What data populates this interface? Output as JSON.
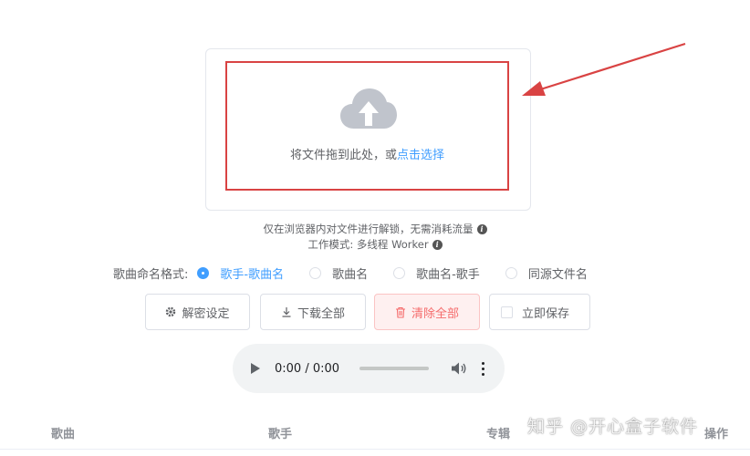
{
  "upload": {
    "drop_text": "将文件拖到此处，或",
    "drop_link": "点击选择"
  },
  "info": {
    "privacy_text": "仅在浏览器内对文件进行解锁，无需消耗流量",
    "mode_text": "工作模式: 多线程 Worker"
  },
  "naming": {
    "label": "歌曲命名格式:",
    "options": [
      {
        "label": "歌手-歌曲名",
        "checked": true
      },
      {
        "label": "歌曲名",
        "checked": false
      },
      {
        "label": "歌曲名-歌手",
        "checked": false
      },
      {
        "label": "同源文件名",
        "checked": false
      }
    ]
  },
  "buttons": {
    "decrypt_settings": "解密设定",
    "download_all": "下载全部",
    "clear_all": "清除全部",
    "save_now": "立即保存"
  },
  "player": {
    "time": "0:00 / 0:00",
    "progress": 0
  },
  "table": {
    "columns": [
      "歌曲",
      "歌手",
      "专辑",
      "操作"
    ]
  },
  "watermark": "知乎 @开心盒子软件",
  "colors": {
    "accent": "#409eff",
    "danger": "#f56c6c",
    "highlight_border": "#d94343"
  }
}
